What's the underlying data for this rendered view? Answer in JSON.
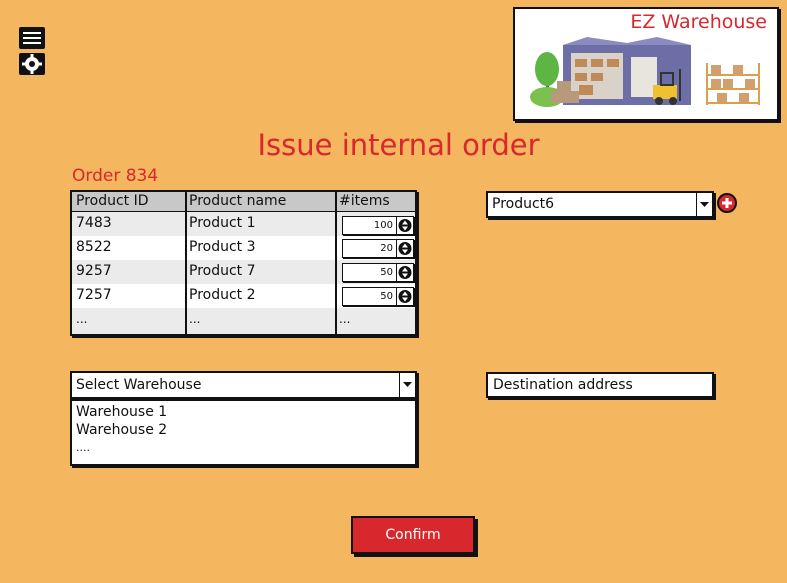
{
  "sidebar": {
    "icons": [
      "list-icon",
      "gear-icon"
    ]
  },
  "logo": {
    "title": "EZ Warehouse"
  },
  "page": {
    "title": "Issue internal order",
    "order_label": "Order 834"
  },
  "table": {
    "headers": [
      "Product ID",
      "Product name",
      "#items"
    ],
    "rows": [
      {
        "id": "7483",
        "name": "Product 1",
        "items": "100"
      },
      {
        "id": "8522",
        "name": "Product 3",
        "items": "20"
      },
      {
        "id": "9257",
        "name": "Product 7",
        "items": "50"
      },
      {
        "id": "7257",
        "name": "Product 2",
        "items": "50"
      }
    ],
    "ellipsis": "...",
    "ellipsis_items": "..."
  },
  "product_select": {
    "value": "Product6"
  },
  "warehouse": {
    "placeholder": "Select Warehouse",
    "options": [
      "Warehouse 1",
      "Warehouse 2",
      "...."
    ]
  },
  "destination": {
    "placeholder": "Destination address"
  },
  "actions": {
    "confirm_label": "Confirm"
  },
  "colors": {
    "background": "#f4b65e",
    "accent": "#d8282e"
  }
}
